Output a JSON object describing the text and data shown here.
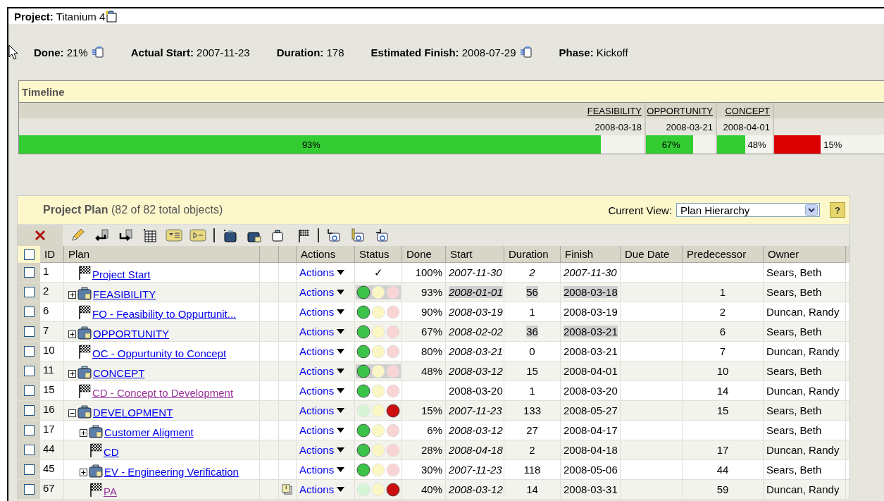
{
  "project": {
    "title": "**Project:** Titanium 4"
  },
  "stats": [
    {
      "text": "**Done:** 21%",
      "clipboard": true
    },
    {
      "text": "**Actual Start:** 2007-11-23",
      "clipboard": false
    },
    {
      "text": "**Duration:** 178",
      "clipboard": false
    },
    {
      "text": "**Estimated Finish:** 2008-07-29",
      "clipboard": true
    },
    {
      "text": "**Phase:** Kickoff",
      "clipboard": false
    }
  ],
  "timeline": {
    "title": "Timeline",
    "segments": [
      {
        "label": "FEASIBILITY",
        "date": "2008-03-18",
        "percent": "93%",
        "level": 0.93,
        "color": "#33cc33"
      },
      {
        "label": "OPPORTUNITY",
        "date": "2008-03-21",
        "percent": "67%",
        "level": 0.68,
        "color": "#33cc33"
      },
      {
        "label": "CONCEPT",
        "date": "2008-04-01",
        "percent": "48%",
        "level": 0.5,
        "color": "#33cc33"
      },
      {
        "percent": "15%",
        "level": 0.39,
        "color": "#dd0000"
      }
    ]
  },
  "plan": {
    "title": "**Project Plan** (82 of 82 total objects)",
    "view_label": "Current View:",
    "view": "Plan Hierarchy",
    "help": "?",
    "select_all_checked": false,
    "columns": [
      "ID",
      "Plan",
      "Actions",
      "Status",
      "Done",
      "Start",
      "Duration",
      "Finish",
      "Due Date",
      "Predecessor",
      "Owner"
    ],
    "rows": [
      {
        "id": "1",
        "plan": "Project Start",
        "kind": "milestone",
        "visited": false,
        "note": false,
        "checked": false,
        "actions": "Actions",
        "status": {
          "kind": "check",
          "mark": "✓"
        },
        "done": "100%",
        "start": {
          "text": "2007-11-30",
          "italic": true,
          "highlighted": false
        },
        "duration": {
          "text": "2",
          "italic": true,
          "highlighted": false
        },
        "finish": {
          "text": "2007-11-30",
          "italic": true,
          "highlighted": false
        },
        "owner": "Sears, Beth"
      },
      {
        "id": "2",
        "plan": "FEASIBILITY",
        "kind": "phase",
        "expanded": false,
        "visited": false,
        "note": false,
        "checked": false,
        "actions": "Actions",
        "status": {
          "kind": "lights",
          "shaded": true,
          "lights": [
            {
              "on": true
            },
            {
              "on": false
            },
            {
              "on": false
            }
          ]
        },
        "done": "93%",
        "start": {
          "text": "2008-01-01",
          "italic": true,
          "highlighted": true
        },
        "duration": {
          "text": "56",
          "italic": false,
          "highlighted": true
        },
        "finish": {
          "text": "2008-03-18",
          "italic": false,
          "highlighted": true
        },
        "predecessor": "1",
        "owner": "Sears, Beth"
      },
      {
        "id": "6",
        "plan": "FO - Feasibility to Oppurtunit...",
        "kind": "milestone",
        "visited": false,
        "note": false,
        "checked": false,
        "actions": "Actions",
        "status": {
          "kind": "lights",
          "shaded": false,
          "lights": [
            {
              "on": true
            },
            {
              "on": false
            },
            {
              "on": false
            }
          ]
        },
        "done": "90%",
        "start": {
          "text": "2008-03-19",
          "italic": true,
          "highlighted": false
        },
        "duration": {
          "text": "1",
          "italic": false,
          "highlighted": false
        },
        "finish": {
          "text": "2008-03-19",
          "italic": false,
          "highlighted": false
        },
        "predecessor": "2",
        "owner": "Duncan, Randy"
      },
      {
        "id": "7",
        "plan": "OPPORTUNITY",
        "kind": "phase",
        "expanded": false,
        "visited": false,
        "note": false,
        "checked": false,
        "actions": "Actions",
        "status": {
          "kind": "lights",
          "shaded": false,
          "lights": [
            {
              "on": true
            },
            {
              "on": false
            },
            {
              "on": false
            }
          ]
        },
        "done": "67%",
        "start": {
          "text": "2008-02-02",
          "italic": true,
          "highlighted": false
        },
        "duration": {
          "text": "36",
          "italic": false,
          "highlighted": true
        },
        "finish": {
          "text": "2008-03-21",
          "italic": false,
          "highlighted": true
        },
        "predecessor": "6",
        "owner": "Sears, Beth"
      },
      {
        "id": "10",
        "plan": "OC - Oppurtunity to Concept",
        "kind": "milestone",
        "visited": false,
        "note": false,
        "checked": false,
        "actions": "Actions",
        "status": {
          "kind": "lights",
          "shaded": false,
          "lights": [
            {
              "on": true
            },
            {
              "on": false
            },
            {
              "on": false
            }
          ]
        },
        "done": "80%",
        "start": {
          "text": "2008-03-21",
          "italic": true,
          "highlighted": false
        },
        "duration": {
          "text": "0",
          "italic": false,
          "highlighted": false
        },
        "finish": {
          "text": "2008-03-21",
          "italic": false,
          "highlighted": false
        },
        "predecessor": "7",
        "owner": "Duncan, Randy"
      },
      {
        "id": "11",
        "plan": "CONCEPT",
        "kind": "phase",
        "expanded": false,
        "visited": false,
        "note": false,
        "checked": false,
        "actions": "Actions",
        "status": {
          "kind": "lights",
          "shaded": true,
          "lights": [
            {
              "on": true
            },
            {
              "on": false
            },
            {
              "on": false
            }
          ]
        },
        "done": "48%",
        "start": {
          "text": "2008-03-12",
          "italic": true,
          "highlighted": false
        },
        "duration": {
          "text": "15",
          "italic": false,
          "highlighted": false
        },
        "finish": {
          "text": "2008-04-01",
          "italic": false,
          "highlighted": false
        },
        "predecessor": "10",
        "owner": "Sears, Beth"
      },
      {
        "id": "15",
        "plan": "CD - Concept to Development",
        "kind": "milestone",
        "visited": true,
        "note": false,
        "checked": false,
        "actions": "Actions",
        "status": {
          "kind": "lights",
          "shaded": false,
          "lights": [
            {
              "on": true
            },
            {
              "on": false
            },
            {
              "on": false
            }
          ]
        },
        "start": {
          "text": "2008-03-20",
          "italic": false,
          "highlighted": false
        },
        "duration": {
          "text": "1",
          "italic": false,
          "highlighted": false
        },
        "finish": {
          "text": "2008-03-20",
          "italic": false,
          "highlighted": false
        },
        "predecessor": "14",
        "owner": "Duncan, Randy"
      },
      {
        "id": "16",
        "plan": "DEVELOPMENT",
        "kind": "phase",
        "expanded": true,
        "visited": false,
        "note": false,
        "checked": false,
        "actions": "Actions",
        "status": {
          "kind": "lights",
          "shaded": false,
          "lights": [
            {
              "on": false
            },
            {
              "on": false
            },
            {
              "on": true
            }
          ]
        },
        "done": "15%",
        "start": {
          "text": "2007-11-23",
          "italic": true,
          "highlighted": false
        },
        "duration": {
          "text": "133",
          "italic": false,
          "highlighted": false
        },
        "finish": {
          "text": "2008-05-27",
          "italic": false,
          "highlighted": false
        },
        "predecessor": "15",
        "owner": "Sears, Beth",
        "children": [
          {
            "id": "17",
            "plan": "Customer Aligment",
            "kind": "phase",
            "expanded": false,
            "visited": false,
            "note": false,
            "checked": false,
            "actions": "Actions",
            "status": {
              "kind": "lights",
              "shaded": false,
              "lights": [
                {
                  "on": true
                },
                {
                  "on": false
                },
                {
                  "on": false
                }
              ]
            },
            "done": "6%",
            "start": {
              "text": "2008-03-12",
              "italic": true,
              "highlighted": false
            },
            "duration": {
              "text": "27",
              "italic": false,
              "highlighted": false
            },
            "finish": {
              "text": "2008-04-17",
              "italic": false,
              "highlighted": false
            },
            "owner": "Sears, Beth"
          },
          {
            "id": "44",
            "plan": "CD",
            "kind": "milestone",
            "visited": false,
            "note": false,
            "checked": false,
            "actions": "Actions",
            "status": {
              "kind": "lights",
              "shaded": false,
              "lights": [
                {
                  "on": true
                },
                {
                  "on": false
                },
                {
                  "on": false
                }
              ]
            },
            "done": "28%",
            "start": {
              "text": "2008-04-18",
              "italic": true,
              "highlighted": false
            },
            "duration": {
              "text": "2",
              "italic": false,
              "highlighted": false
            },
            "finish": {
              "text": "2008-04-18",
              "italic": false,
              "highlighted": false
            },
            "predecessor": "17",
            "owner": "Duncan, Randy"
          },
          {
            "id": "45",
            "plan": "EV - Engineering Verification",
            "kind": "phase",
            "expanded": false,
            "visited": false,
            "note": false,
            "checked": false,
            "actions": "Actions",
            "status": {
              "kind": "lights",
              "shaded": false,
              "lights": [
                {
                  "on": true
                },
                {
                  "on": false
                },
                {
                  "on": false
                }
              ]
            },
            "done": "30%",
            "start": {
              "text": "2007-11-23",
              "italic": true,
              "highlighted": false
            },
            "duration": {
              "text": "118",
              "italic": false,
              "highlighted": false
            },
            "finish": {
              "text": "2008-05-06",
              "italic": false,
              "highlighted": false
            },
            "predecessor": "44",
            "owner": "Sears, Beth"
          },
          {
            "id": "67",
            "plan": "PA",
            "kind": "milestone",
            "visited": true,
            "note": true,
            "checked": false,
            "actions": "Actions",
            "status": {
              "kind": "lights",
              "shaded": false,
              "lights": [
                {
                  "on": false
                },
                {
                  "on": false
                },
                {
                  "on": true
                }
              ]
            },
            "done": "40%",
            "start": {
              "text": "2008-03-12",
              "italic": true,
              "highlighted": false
            },
            "duration": {
              "text": "14",
              "italic": false,
              "highlighted": false
            },
            "finish": {
              "text": "2008-03-31",
              "italic": false,
              "highlighted": false
            },
            "predecessor": "59",
            "owner": "Duncan, Randy"
          }
        ]
      }
    ]
  }
}
